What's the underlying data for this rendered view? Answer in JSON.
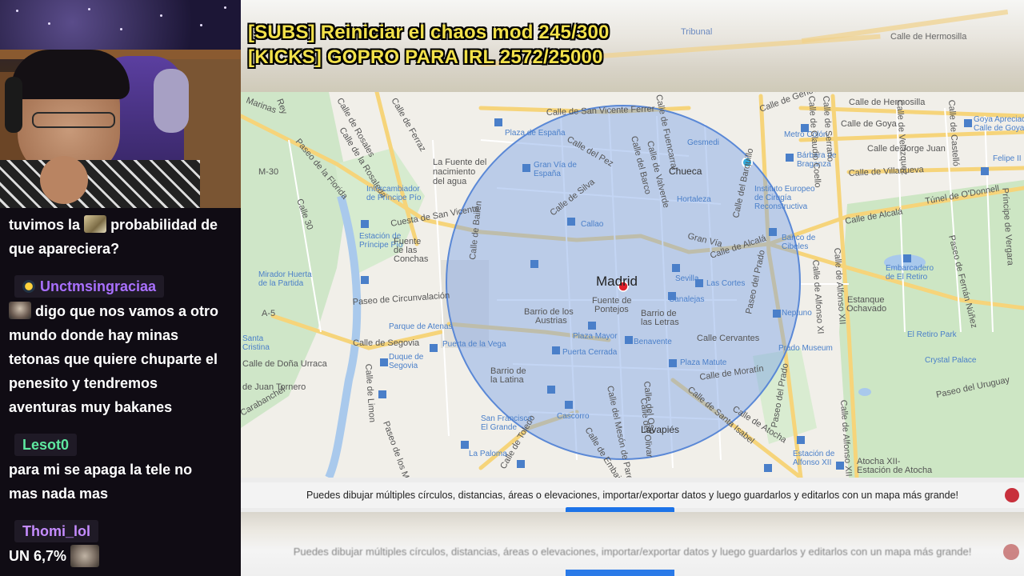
{
  "overlay": {
    "line1": "[SUBS] Reiniciar el chaos mod 245/300",
    "line2": "[KICKS] GOPRO PARA IRL 2572/25000"
  },
  "chat": {
    "messages": [
      {
        "text_before": "tuvimos la",
        "emote": "emote",
        "text_after": "probabilidad de",
        "line2": "que apareciera?"
      },
      {
        "user": "Unctmsingraciaa",
        "user_color": "#a970ff",
        "lines": [
          "digo que nos vamos a otro",
          "mundo donde hay minas",
          "tetonas que quiere chuparte el",
          "penesito y tendremos",
          "aventuras muy bakanes"
        ]
      },
      {
        "user": "Lesot0",
        "user_color": "#5ee8a0",
        "lines": [
          "para mi se apaga la tele no",
          "mas nada mas"
        ]
      },
      {
        "user": "Thomi_lol",
        "user_color": "#c58cff",
        "lines": [
          "UN 6,7%"
        ]
      }
    ]
  },
  "map": {
    "city": "Madrid",
    "labels": {
      "marinas": "Marinas",
      "rey": "Rey",
      "calle_rosales": "Calle de Rosales",
      "ferraz": "Calle de Ferraz",
      "florida": "Paseo de la Florida",
      "rosaleda": "Calle de la Rosaleda",
      "m30": "M-30",
      "fuente_nacimiento_1": "La Fuente del",
      "fuente_nacimiento_2": "nacimiento",
      "fuente_nacimiento_3": "del agua",
      "intercambiador_1": "Intercambiador",
      "intercambiador_2": "de Príncipe Pío",
      "cuesta_san_vicente": "Cuesta de San Vicente",
      "calle30": "Calle 30",
      "estacion_pp_1": "Estación de",
      "estacion_pp_2": "Príncipe Pío",
      "fuente_conchas_1": "Fuente",
      "fuente_conchas_2": "de las",
      "fuente_conchas_3": "Conchas",
      "mirador_1": "Mirador Huerta",
      "mirador_2": "de la Partida",
      "circunvalacion": "Paseo de Circunvalación",
      "a5": "A-5",
      "parque_atenas": "Parque de Atenas",
      "calle_segovia": "Calle de Segovia",
      "puerta_vega": "Puerta de la Vega",
      "duque_1": "Duque de",
      "duque_2": "Segovia",
      "dona_urraca": "Calle de Doña Urraca",
      "juan_tornero": "de Juan Tornero",
      "carabanchel": "Carabanchel",
      "santa": "Santa",
      "cristina": "Cristina",
      "san_vicente_ferrer": "Calle de San Vicente Ferrer",
      "fuencarral": "Calle de Fuencarral",
      "plaza_espana": "Plaza de España",
      "calle_pez": "Calle del Pez",
      "gran_via_espana_1": "Gran Vía de",
      "gran_via_espana_2": "España",
      "calle_barco": "Calle del Barco",
      "calle_valverde": "Calle de Valverde",
      "chueca": "Chueca",
      "calle_silva": "Calle de Silva",
      "hortaleza": "Hortaleza",
      "gran_via": "Gran Vía",
      "callao": "Callao",
      "calle_bailen": "Calle de Bailén",
      "sevilla": "Sevilla",
      "las_cortes": "Las Cortes",
      "fuente_pontejos_1": "Fuente de",
      "fuente_pontejos_2": "Pontejos",
      "canalejas": "Canalejas",
      "barrio_austrias_1": "Barrio de los",
      "barrio_austrias_2": "Austrias",
      "barrio_letras_1": "Barrio de",
      "barrio_letras_2": "las Letras",
      "plaza_mayor": "Plaza Mayor",
      "benavente": "Benavente",
      "puerta_cerrada": "Puerta Cerrada",
      "calle_cervantes": "Calle Cervantes",
      "plaza_matute": "Plaza Matute",
      "barrio_latina_1": "Barrio de",
      "barrio_latina_2": "la Latina",
      "calle_moratin": "Calle de Moratín",
      "calle_atocha": "Calle de Atocha",
      "calle_oso": "Calle del Oso",
      "calle_olivar": "Calle del Olivar",
      "mesón_paredes": "Calle del Mesón de Paredes",
      "santa_isabel": "Calle de Santa Isabel",
      "embajadores": "Calle de Embaj",
      "lavapies": "Lavapiés",
      "toledo": "Calle de Toledo",
      "san_francisco_1": "San Francisco",
      "san_francisco_2": "El Grande",
      "cascorro": "Cascorro",
      "la_paloma": "La Paloma",
      "calle_limon": "Calle de Limon",
      "melancolicos": "Paseo de los Melancólicos",
      "paseo_prado": "Paseo del Prado",
      "calle_alcala": "Calle de Alcalá",
      "paseo_prado_2": "Paseo del Prado",
      "neptuno": "Neptuno",
      "prado_museum": "Prado Museum",
      "cibeles": "Cibeles",
      "banco_espana": "Banco de",
      "gesmedi": "Gesmedi",
      "calle_barquillo": "Calle del Barquillo",
      "instituto_1": "Instituto Europeo",
      "instituto_2": "de Cirugía",
      "instituto_3": "Reconstructiva",
      "metro_colon": "Metro Colón",
      "barbara_1": "Bárbara de",
      "barbara_2": "Braganza",
      "genova": "Calle de Génova",
      "hermosilla": "Calle de Hermosilla",
      "goya": "Calle de Goya",
      "jorge_juan": "Calle de Jorge Juan",
      "villanueva": "Calle de Villanueva",
      "alcala_2": "Calle de Alcalá",
      "odonnell": "Túnel de O'Donnell",
      "alfonso_xi": "Calle de Alfonso XI",
      "alfonso_xii": "Calle de Alfonso XII",
      "alfonso_xii_b": "Calle de Alfonso XII",
      "embarcadero_1": "Embarcadero",
      "embarcadero_2": "de El Retiro",
      "estanque_1": "Estanque",
      "estanque_2": "Ochavado",
      "retiro_park": "El Retiro Park",
      "crystal_palace": "Crystal Palace",
      "paseo_uruguay": "Paseo del Uruguay",
      "fernan_nunez": "Paseo de Fernán Núñez",
      "velazquez": "Calle de Velázquez",
      "castello": "Calle de Castelló",
      "claudio_coello": "Calle de Claudio Coello",
      "serrano": "Calle de Serrano",
      "goya_metro_1": "Goya Apreciac",
      "goya_metro_2": "Calle de Goya",
      "felipe": "Felipe II",
      "principe_vergara": "Príncipe de Vergara",
      "estacion_alfonso_1": "Estación de",
      "estacion_alfonso_2": "Alfonso XII",
      "atocha_1": "Atocha XII-",
      "atocha_2": "Estación de Atocha"
    }
  },
  "info_bar": {
    "text": "Puedes dibujar múltiples círculos, distancias, áreas o elevaciones, importar/exportar datos y luego guardarlos y editarlos con un mapa más grande!"
  },
  "top_blur": {
    "labels": [
      "Tribunal",
      "Calle de Hermosilla"
    ]
  },
  "colors": {
    "overlay_text": "#f2e14a",
    "circle_fill": "#7aa2e6",
    "circle_stroke": "#5a88d6",
    "marker": "#e0202c",
    "info_close": "#c8303c",
    "accent_blue": "#1c73e8"
  }
}
